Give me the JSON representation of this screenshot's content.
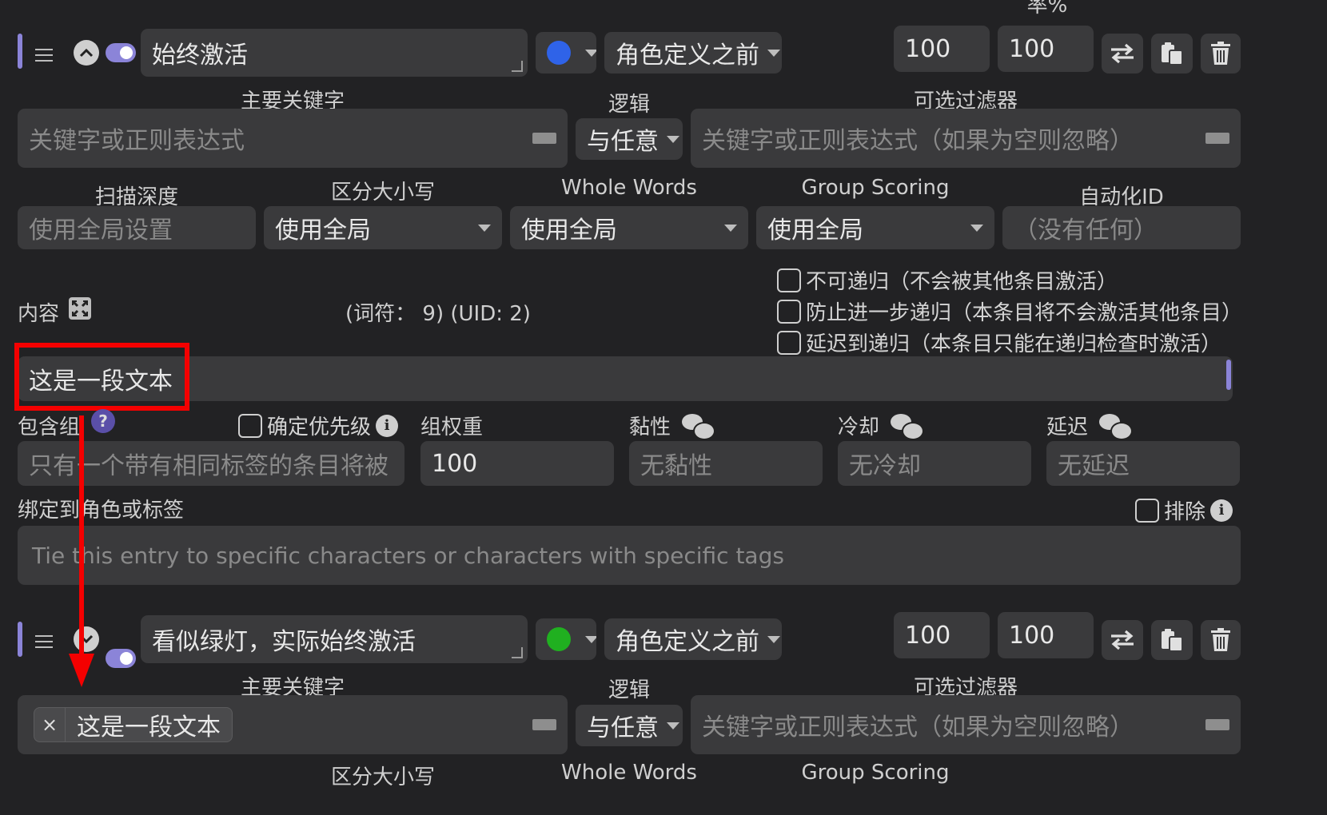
{
  "header_partial": "率%",
  "entry1": {
    "title": "始终激活",
    "position": "角色定义之前",
    "num1": "100",
    "num2": "100",
    "status_color": "#2f63e8",
    "labels": {
      "primary_key": "主要关键字",
      "logic": "逻辑",
      "filter": "可选过滤器",
      "scan_depth": "扫描深度",
      "case": "区分大小写",
      "whole_words": "Whole Words",
      "group_scoring": "Group Scoring",
      "automation_id": "自动化ID",
      "content": "内容",
      "token_info": "(词符： 9) (UID: 2)",
      "include_group": "包含组",
      "priority": "确定优先级",
      "group_weight": "组权重",
      "sticky": "黏性",
      "cooldown": "冷却",
      "delay": "延迟",
      "bind": "绑定到角色或标签",
      "exclude": "排除"
    },
    "primary_key_placeholder": "关键字或正则表达式",
    "logic_value": "与任意",
    "filter_placeholder": "关键字或正则表达式（如果为空则忽略）",
    "scan_depth_placeholder": "使用全局设置",
    "case_value": "使用全局",
    "whole_words_value": "使用全局",
    "group_scoring_value": "使用全局",
    "automation_placeholder": "（没有任何）",
    "options": [
      "不可递归（不会被其他条目激活）",
      "防止进一步递归（本条目将不会激活其他条目）",
      "延迟到递归（本条目只能在递归检查时激活）"
    ],
    "content_text": "这是一段文本",
    "group_placeholder": "只有一个带有相同标签的条目将被",
    "group_weight_value": "100",
    "sticky_placeholder": "无黏性",
    "cooldown_placeholder": "无冷却",
    "delay_placeholder": "无延迟",
    "bind_placeholder": "Tie this entry to specific characters or characters with specific tags"
  },
  "entry2": {
    "title": "看似绿灯，实际始终激活",
    "position": "角色定义之前",
    "num1": "100",
    "num2": "100",
    "status_color": "#20b020",
    "labels": {
      "primary_key": "主要关键字",
      "logic": "逻辑",
      "filter": "可选过滤器",
      "case_partial": "区分大小写",
      "whole_words_partial": "Whole Words",
      "group_scoring_partial": "Group Scoring"
    },
    "key_tag": "这是一段文本",
    "tag_remove": "×",
    "logic_value": "与任意",
    "filter_placeholder": "关键字或正则表达式（如果为空则忽略）"
  },
  "annotation": {
    "color": "#f40000"
  }
}
